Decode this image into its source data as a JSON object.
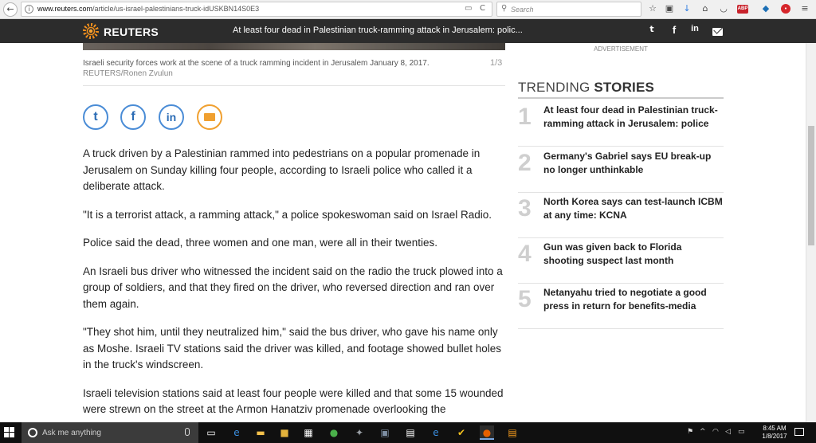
{
  "browser": {
    "url_domain": "www.reuters.com",
    "url_path": "/article/us-israel-palestinians-truck-idUSKBN14S0E3",
    "search_placeholder": "Search",
    "back_glyph": "←",
    "reload_glyph": "C",
    "abp_label": "ABP"
  },
  "nav": {
    "logo": "REUTERS",
    "ticker_headline": "At least four dead in Palestinian truck-ramming attack in Jerusalem: polic...",
    "social": {
      "twitter_glyph": "t",
      "facebook_glyph": "f",
      "linkedin_glyph": "in"
    }
  },
  "photo": {
    "caption": "Israeli security forces work at the scene of a truck ramming incident in Jerusalem January 8, 2017.",
    "credit": "REUTERS/Ronen Zvulun",
    "count": "1/3"
  },
  "share": {
    "twitter_glyph": "t",
    "facebook_glyph": "f",
    "linkedin_glyph": "in"
  },
  "article": {
    "paragraphs": [
      "A truck driven by a Palestinian rammed into pedestrians on a popular promenade in Jerusalem on Sunday killing four people, according to Israeli police who called it a deliberate attack.",
      "\"It is a terrorist attack, a ramming attack,\" a police spokeswoman said on Israel Radio.",
      "Police said the dead, three women and one man, were all in their twenties.",
      "An Israeli bus driver who witnessed the incident said on the radio the truck plowed into a group of soldiers, and that they fired on the driver, who reversed direction and ran over them again.",
      "\"They shot him, until they neutralized him,\" said the bus driver, who gave his name only as Moshe. Israeli TV stations said the driver was killed, and footage showed bullet holes in the truck's windscreen.",
      "Israeli television stations said at least four people were killed and that some 15 wounded were strewn on the street at the Armon Hanatziv promenade overlooking the"
    ]
  },
  "sidebar": {
    "ad_label": "ADVERTISEMENT",
    "trending_light": "TRENDING",
    "trending_bold": "STORIES",
    "stories": [
      {
        "num": "1",
        "title": "At least four dead in Palestinian truck-ramming attack in Jerusalem: police"
      },
      {
        "num": "2",
        "title": "Germany's Gabriel says EU break-up no longer unthinkable"
      },
      {
        "num": "3",
        "title": "North Korea says can test-launch ICBM at any time: KCNA"
      },
      {
        "num": "4",
        "title": "Gun was given back to Florida shooting suspect last month"
      },
      {
        "num": "5",
        "title": "Netanyahu tried to negotiate a good press in return for benefits-media"
      }
    ]
  },
  "taskbar": {
    "search_placeholder": "Ask me anything",
    "time": "8:45 AM",
    "date": "1/8/2017"
  },
  "colors": {
    "reuters_bar": "#2c2c2c",
    "reuters_orange": "#f18f1c",
    "share_blue": "#4a8cd6",
    "email_orange": "#f0a030",
    "taskbar": "#101010"
  }
}
